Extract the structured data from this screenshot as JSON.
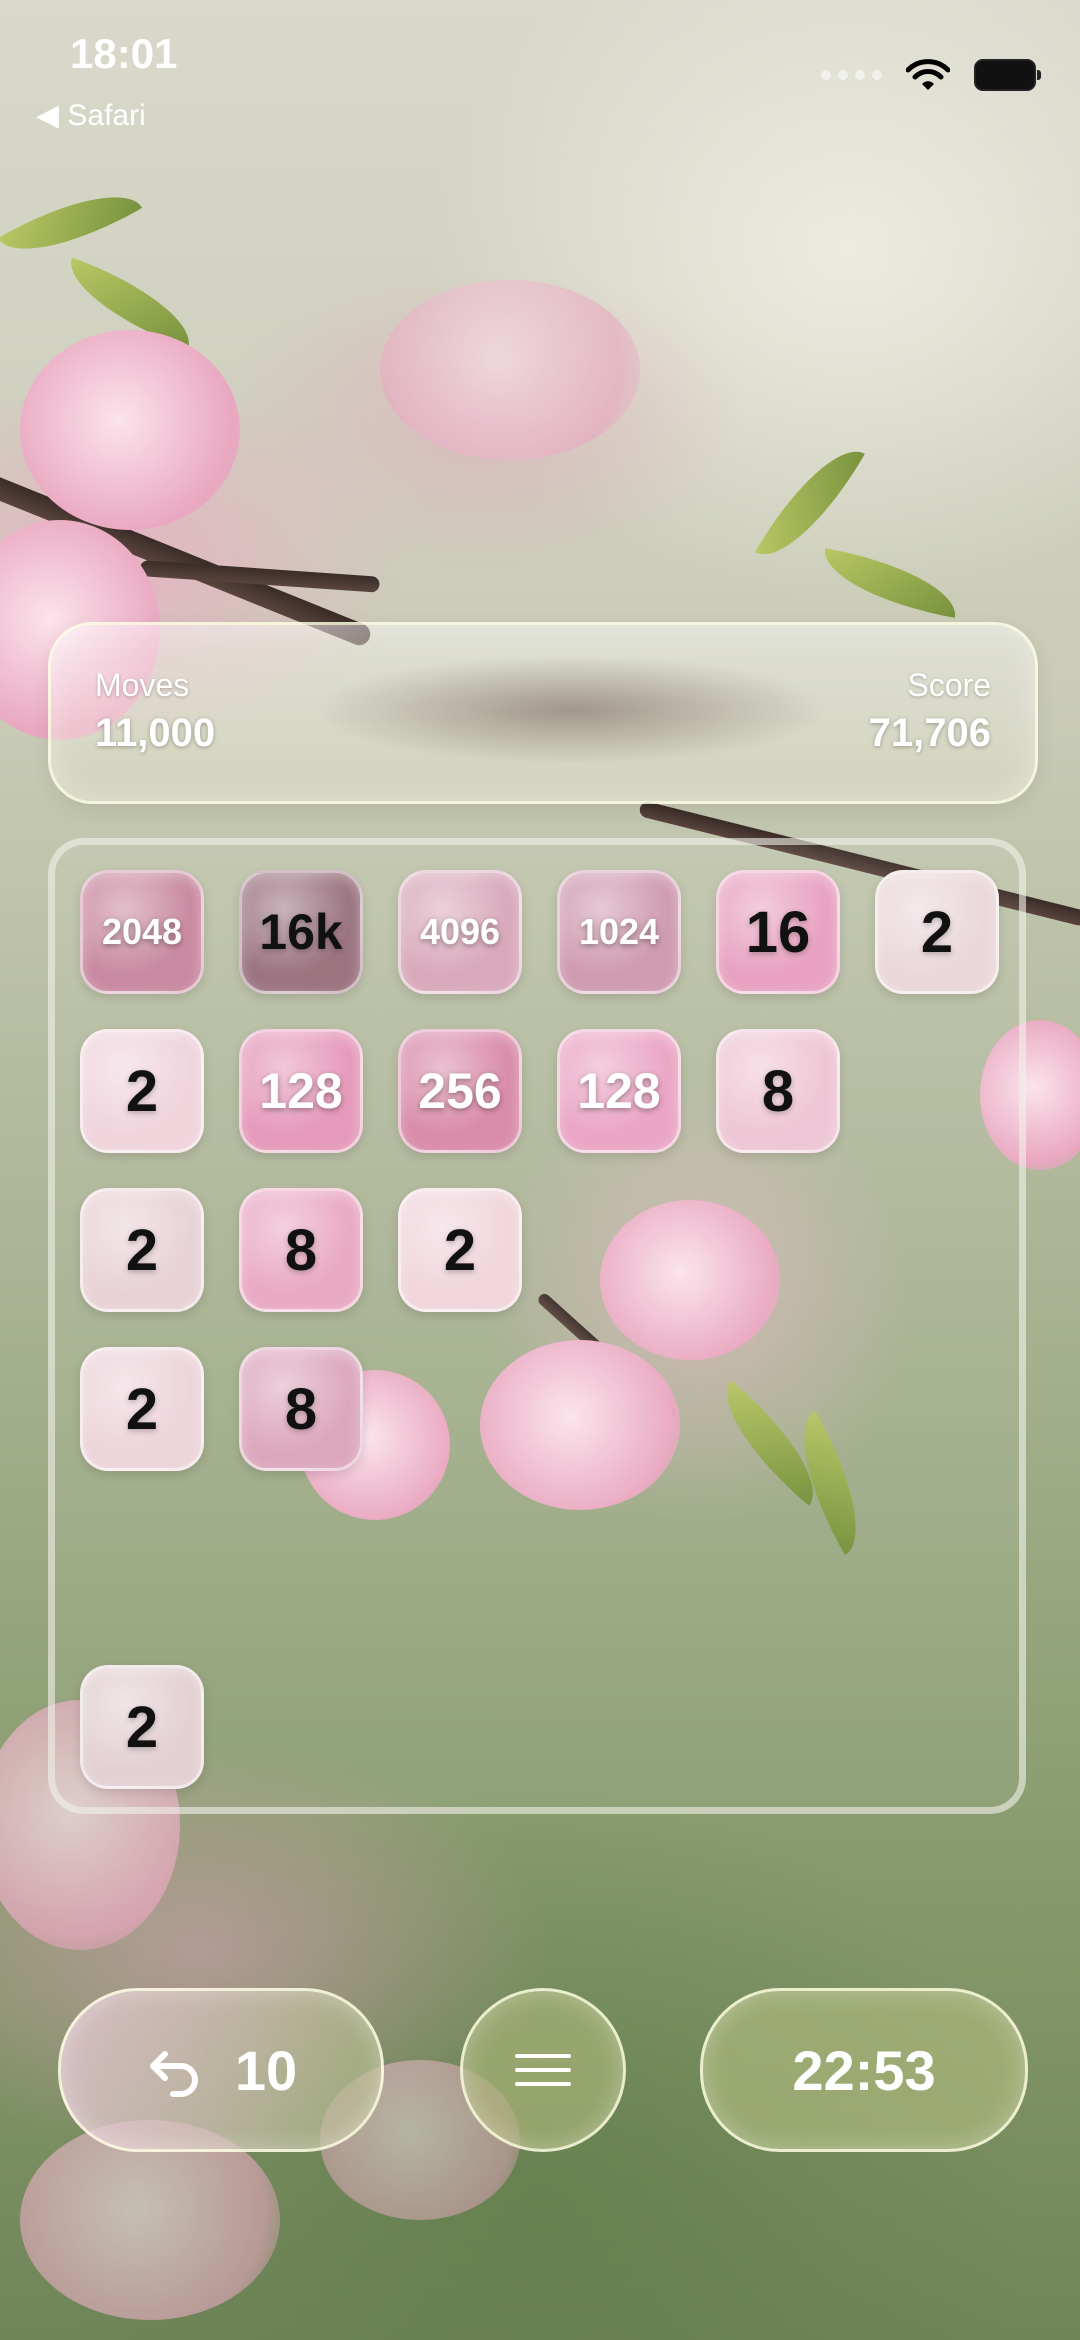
{
  "status_bar": {
    "time": "18:01",
    "back_label": "◀ Safari"
  },
  "stats": {
    "moves_label": "Moves",
    "moves_value": "11,000",
    "score_label": "Score",
    "score_value": "71,706"
  },
  "board": {
    "tiles": [
      {
        "row": 0,
        "col": 0,
        "label": "2048",
        "bg": "#c98aa1"
      },
      {
        "row": 0,
        "col": 1,
        "label": "16k",
        "bg": "#9b7480"
      },
      {
        "row": 0,
        "col": 2,
        "label": "4096",
        "bg": "#d8a9bb"
      },
      {
        "row": 0,
        "col": 3,
        "label": "1024",
        "bg": "#cf9bb0"
      },
      {
        "row": 0,
        "col": 4,
        "label": "16",
        "bg": "#e8a2c0"
      },
      {
        "row": 0,
        "col": 5,
        "label": "2",
        "bg": "#ead7da"
      },
      {
        "row": 1,
        "col": 0,
        "label": "2",
        "bg": "#efd4dc"
      },
      {
        "row": 1,
        "col": 1,
        "label": "128",
        "bg": "#e59aba"
      },
      {
        "row": 1,
        "col": 2,
        "label": "256",
        "bg": "#d98ca9"
      },
      {
        "row": 1,
        "col": 3,
        "label": "128",
        "bg": "#eaa6c4"
      },
      {
        "row": 1,
        "col": 4,
        "label": "8",
        "bg": "#eec6d5"
      },
      {
        "row": 2,
        "col": 0,
        "label": "2",
        "bg": "#e8d2d6"
      },
      {
        "row": 2,
        "col": 1,
        "label": "8",
        "bg": "#e9a9c3"
      },
      {
        "row": 2,
        "col": 2,
        "label": "2",
        "bg": "#f0d5dc"
      },
      {
        "row": 3,
        "col": 0,
        "label": "2",
        "bg": "#ecd4da"
      },
      {
        "row": 3,
        "col": 1,
        "label": "8",
        "bg": "#dca7bd"
      },
      {
        "row": 5,
        "col": 0,
        "label": "2",
        "bg": "#e3d0d3"
      }
    ]
  },
  "controls": {
    "undo_count": "10",
    "undo_icon": "undo-arrow-icon",
    "menu_icon": "hamburger-menu-icon",
    "timer": "22:53"
  }
}
